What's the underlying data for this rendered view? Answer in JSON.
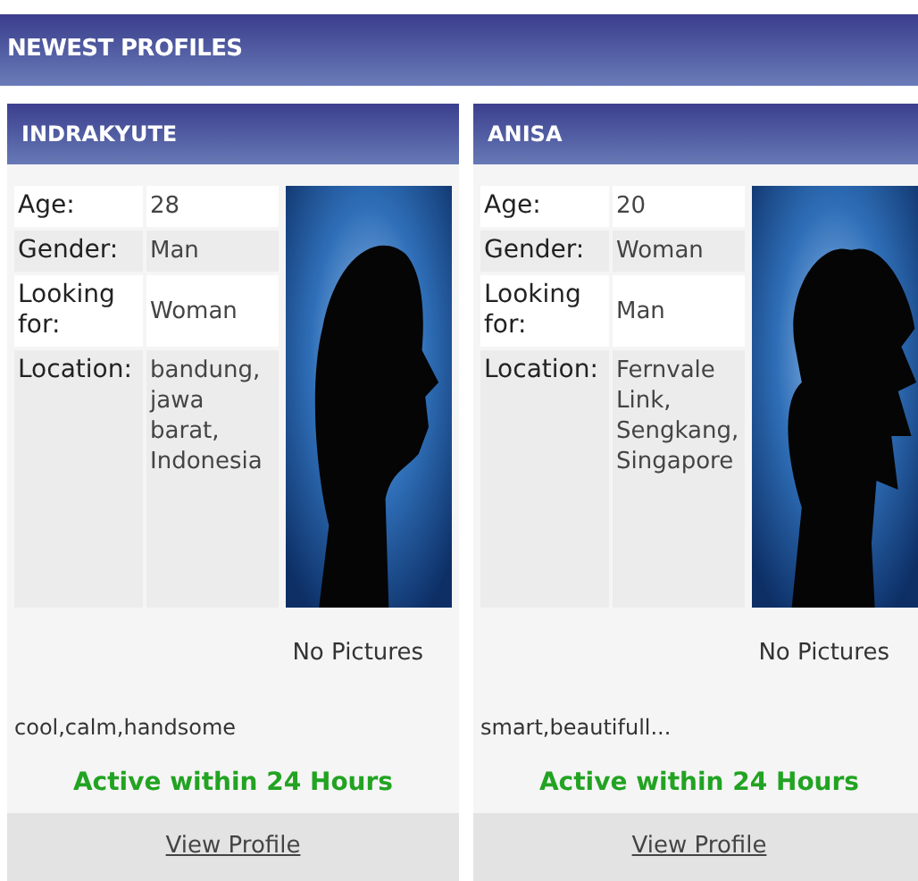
{
  "header": {
    "title": "NEWEST PROFILES"
  },
  "profiles": [
    {
      "name": "INDRAKYUTE",
      "fields": [
        {
          "label": "Age:",
          "value": "28"
        },
        {
          "label": "Gender:",
          "value": "Man"
        },
        {
          "label": "Looking for:",
          "value": "Woman"
        },
        {
          "label": "Location:",
          "value": "bandung, jawa barat, Indonesia"
        }
      ],
      "photo_caption": "No Pictures",
      "description": "cool,calm,handsome",
      "status": "Active within 24 Hours",
      "link": "View Profile"
    },
    {
      "name": "ANISA",
      "fields": [
        {
          "label": "Age:",
          "value": "20"
        },
        {
          "label": "Gender:",
          "value": "Woman"
        },
        {
          "label": "Looking for:",
          "value": "Man"
        },
        {
          "label": "Location:",
          "value": "Fernvale Link, Sengkang, Singapore"
        }
      ],
      "photo_caption": "No Pictures",
      "description": "smart,beautifull...",
      "status": "Active within 24 Hours",
      "link": "View Profile"
    }
  ]
}
